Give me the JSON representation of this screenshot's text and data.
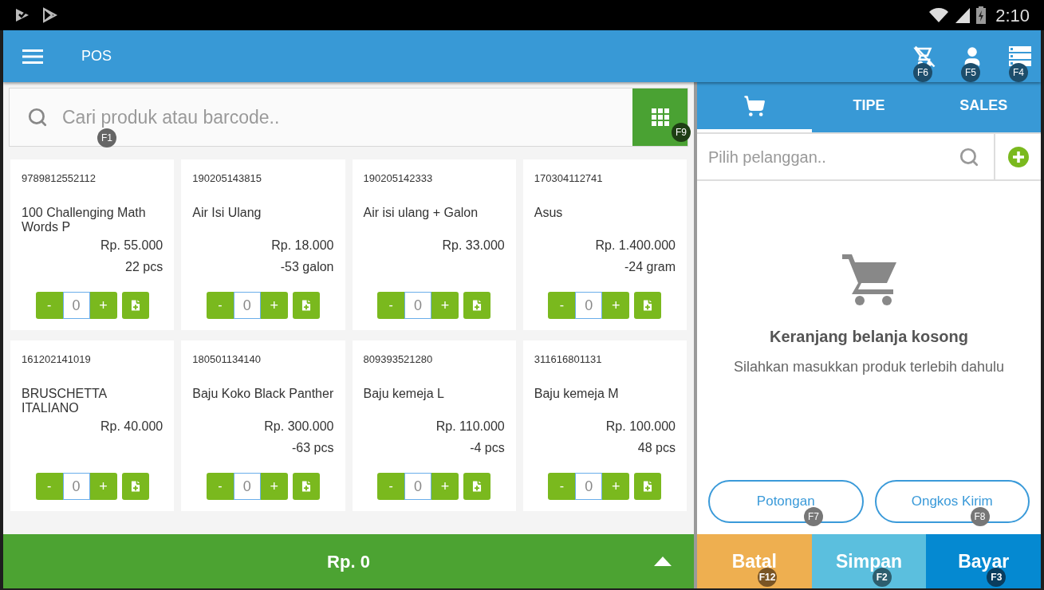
{
  "status_bar": {
    "time": "2:10"
  },
  "app_bar": {
    "title": "POS",
    "actions": [
      {
        "kind": "cart-off",
        "hotkey": "F6"
      },
      {
        "kind": "person",
        "hotkey": "F5"
      },
      {
        "kind": "list",
        "hotkey": "F4"
      }
    ]
  },
  "search": {
    "placeholder": "Cari produk atau barcode..",
    "hotkey": "F1",
    "grid_hotkey": "F9"
  },
  "products": [
    {
      "barcode": "9789812552112",
      "name": "100 Challenging Math Words P",
      "price": "Rp. 55.000",
      "stock": "22 pcs",
      "qty": "0"
    },
    {
      "barcode": "190205143815",
      "name": "Air Isi Ulang",
      "price": "Rp. 18.000",
      "stock": "-53 galon",
      "qty": "0"
    },
    {
      "barcode": "190205142333",
      "name": "Air isi ulang + Galon",
      "price": "Rp. 33.000",
      "qty": "0"
    },
    {
      "barcode": "170304112741",
      "name": "Asus",
      "price": "Rp. 1.400.000",
      "stock": "-24 gram",
      "qty": "0"
    },
    {
      "barcode": "161202141019",
      "name": "BRUSCHETTA ITALIANO",
      "price": "Rp. 40.000",
      "qty": "0"
    },
    {
      "barcode": "180501134140",
      "name": "Baju Koko Black Panther",
      "price": "Rp. 300.000",
      "stock": "-63 pcs",
      "qty": "0"
    },
    {
      "barcode": "809393521280",
      "name": "Baju kemeja L",
      "price": "Rp. 110.000",
      "stock": "-4 pcs",
      "qty": "0"
    },
    {
      "barcode": "311616801131",
      "name": "Baju kemeja M",
      "price": "Rp. 100.000",
      "stock": "48 pcs",
      "qty": "0"
    }
  ],
  "controls": {
    "minus": "-",
    "plus": "+"
  },
  "total_bar": {
    "total": "Rp. 0"
  },
  "tabs": [
    {
      "kind": "cart",
      "selected": true
    },
    {
      "label": "TIPE",
      "selected": false
    },
    {
      "label": "SALES",
      "selected": false
    }
  ],
  "customer": {
    "placeholder": "Pilih pelanggan.."
  },
  "empty_cart": {
    "title": "Keranjang belanja kosong",
    "message": "Silahkan masukkan produk terlebih dahulu"
  },
  "extra_buttons": [
    {
      "label": "Potongan",
      "hotkey": "F7"
    },
    {
      "label": "Ongkos Kirim",
      "hotkey": "F8"
    }
  ],
  "actions": [
    {
      "kind": "cancel",
      "label": "Batal",
      "hotkey": "F12"
    },
    {
      "kind": "save",
      "label": "Simpan",
      "hotkey": "F2"
    },
    {
      "kind": "pay",
      "label": "Bayar",
      "hotkey": "F3"
    }
  ]
}
